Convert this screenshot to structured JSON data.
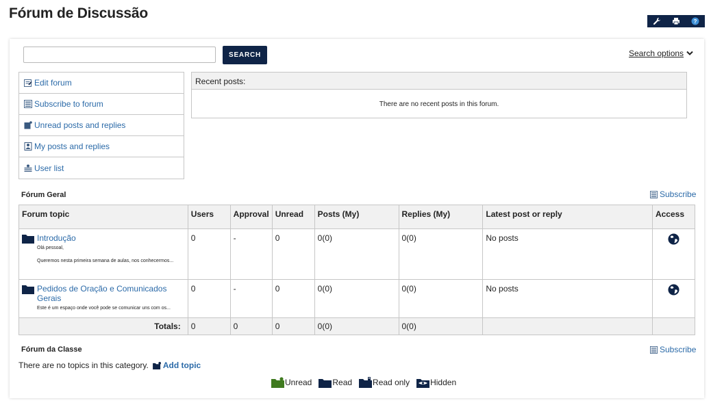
{
  "page": {
    "title": "Fórum de Discussão"
  },
  "toolbar": {
    "icons": [
      "wrench-icon",
      "print-icon",
      "help-icon"
    ]
  },
  "search": {
    "value": "",
    "placeholder": "",
    "button_label": "SEARCH",
    "options_label": "Search options"
  },
  "actions": [
    {
      "label": "Edit forum",
      "icon": "edit-icon"
    },
    {
      "label": "Subscribe to forum",
      "icon": "subscribe-icon"
    },
    {
      "label": "Unread posts and replies",
      "icon": "unread-icon"
    },
    {
      "label": "My posts and replies",
      "icon": "my-posts-icon"
    },
    {
      "label": "User list",
      "icon": "user-list-icon"
    }
  ],
  "recent": {
    "header": "Recent posts:",
    "empty_message": "There are no recent posts in this forum."
  },
  "categories": [
    {
      "title": "Fórum Geral",
      "subscribe_label": "Subscribe",
      "columns": [
        "Forum topic",
        "Users",
        "Approval",
        "Unread",
        "Posts (My)",
        "Replies (My)",
        "Latest post or reply",
        "Access"
      ],
      "topics": [
        {
          "name": "Introdução",
          "description": [
            "Olá pessoal,",
            "Queremos nesta primeira semana de aulas, nos conhecermos..."
          ],
          "users": "0",
          "approval": "-",
          "unread": "0",
          "posts": "0(0)",
          "replies": "0(0)",
          "latest": "No posts",
          "access_icon": "globe-icon"
        },
        {
          "name": "Pedidos de Oração e Comunicados Gerais",
          "description": [
            "Este é um espaço onde você pode se comunicar uns com os..."
          ],
          "users": "0",
          "approval": "-",
          "unread": "0",
          "posts": "0(0)",
          "replies": "0(0)",
          "latest": "No posts",
          "access_icon": "globe-icon"
        }
      ],
      "totals": {
        "label": "Totals:",
        "users": "0",
        "approval": "0",
        "unread": "0",
        "posts": "0(0)",
        "replies": "0(0)"
      }
    },
    {
      "title": "Fórum da Classe",
      "subscribe_label": "Subscribe",
      "empty_message": "There are no topics in this category.",
      "add_topic_label": "Add topic"
    }
  ],
  "legend": [
    {
      "label": "Unread",
      "color": "#3f7a1f"
    },
    {
      "label": "Read",
      "color": "#0f2447"
    },
    {
      "label": "Read only",
      "color": "#0f2447"
    },
    {
      "label": "Hidden",
      "color": "#0f2447"
    }
  ],
  "colors": {
    "navy": "#0f2447",
    "link": "#2b6aa8",
    "unread_green": "#3f7a1f"
  }
}
